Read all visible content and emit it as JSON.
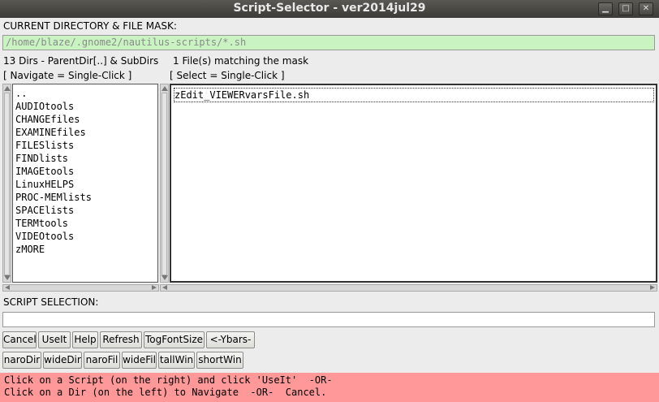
{
  "window": {
    "title": "Script-Selector - ver2014jul29"
  },
  "dir_mask": {
    "label": "CURRENT DIRECTORY & FILE MASK:",
    "value": "/home/blaze/.gnome2/nautilus-scripts/*.sh"
  },
  "left_panel": {
    "header": "13 Dirs - ParentDir[..] & SubDirs",
    "hint": "[ Navigate = Single-Click ]",
    "items": [
      "..",
      "AUDIOtools",
      "CHANGEfiles",
      "EXAMINEfiles",
      "FILESlists",
      "FINDlists",
      "IMAGEtools",
      "LinuxHELPS",
      "PROC-MEMlists",
      "SPACElists",
      "TERMtools",
      "VIDEOtools",
      "zMORE"
    ]
  },
  "right_panel": {
    "header": "1 File(s) matching the mask",
    "hint": "[ Select = Single-Click ]",
    "items": [
      "zEdit_VIEWERvarsFile.sh"
    ]
  },
  "selection": {
    "label": "SCRIPT SELECTION:",
    "value": ""
  },
  "buttons_row1": [
    "Cancel",
    "UseIt",
    "Help",
    "Refresh",
    "TogFontSize",
    "<-Ybars->"
  ],
  "buttons_row2": [
    "naroDir",
    "wideDir",
    "naroFil",
    "wideFil",
    "tallWin",
    "shortWin"
  ],
  "message": {
    "line1": "Click on a Script (on the right) and click 'UseIt'  -OR-",
    "line2": "Click on a Dir (on the left) to Navigate  -OR-  Cancel."
  },
  "colors": {
    "mask_bg": "#c9f4c2",
    "message_bg": "#ff9898",
    "titlebar": "#3d3b37"
  }
}
